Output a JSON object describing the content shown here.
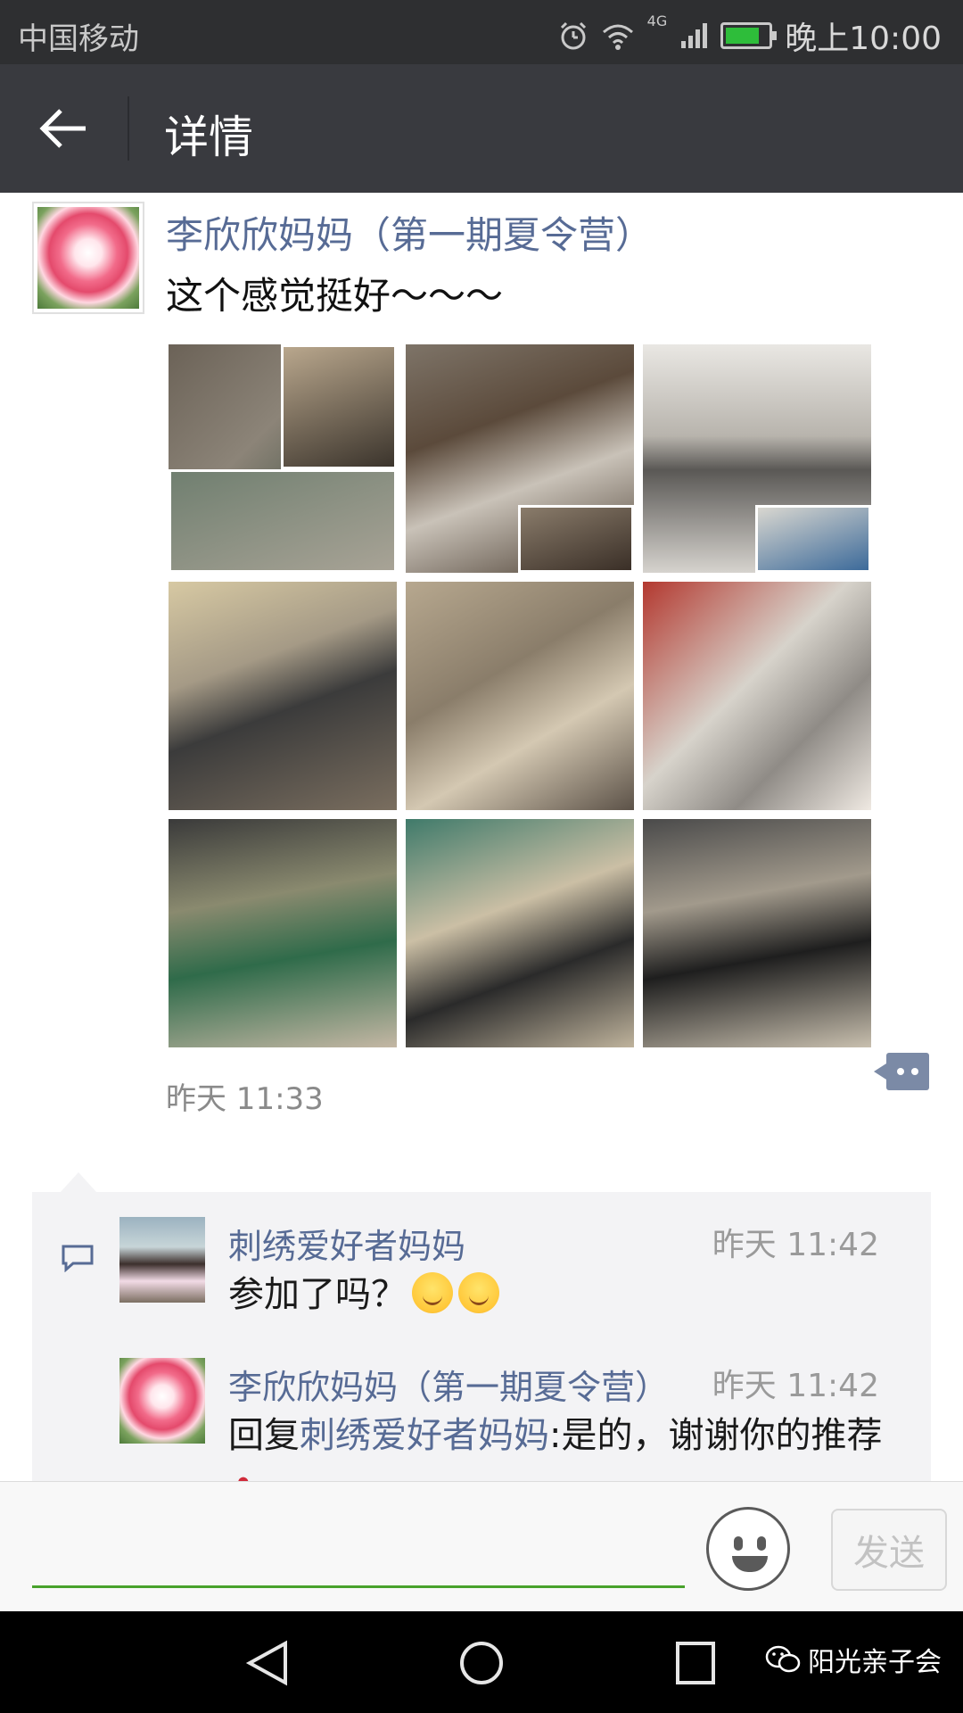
{
  "status_bar": {
    "carrier": "中国移动",
    "network": "4G",
    "time": "晚上10:00",
    "icons": [
      "alarm-icon",
      "wifi-icon",
      "signal-icon",
      "battery-charging-icon"
    ],
    "battery_color": "#2ebd3a"
  },
  "nav": {
    "back_icon": "arrow-left-icon",
    "title": "详情"
  },
  "post": {
    "author": "李欣欣妈妈（第一期夏令营）",
    "text": "这个感觉挺好～～～",
    "photo_count": 9,
    "time": "昨天 11:33",
    "comment_icon": "more-comment-icon"
  },
  "comments": [
    {
      "name": "刺绣爱好者妈妈",
      "time": "昨天 11:42",
      "text": "参加了吗？",
      "emojis": [
        "smile-emoji",
        "smile-emoji"
      ]
    },
    {
      "name": "李欣欣妈妈（第一期夏令营）",
      "time": "昨天 11:42",
      "reply_prefix": "回复",
      "reply_to": "刺绣爱好者妈妈",
      "text": ":是的，谢谢你的推荐",
      "emojis": [
        "rose-emoji"
      ]
    }
  ],
  "input_bar": {
    "emoji_icon": "emoji-face-icon",
    "send_label": "发送",
    "accent_color": "#48a22c"
  },
  "system_nav": {
    "buttons": [
      "back-triangle-icon",
      "home-circle-icon",
      "recents-square-icon"
    ],
    "watermark": "阳光亲子会"
  },
  "colors": {
    "link": "#576b95",
    "nav_bg": "#393a3f",
    "status_bg": "#2e2f31"
  }
}
